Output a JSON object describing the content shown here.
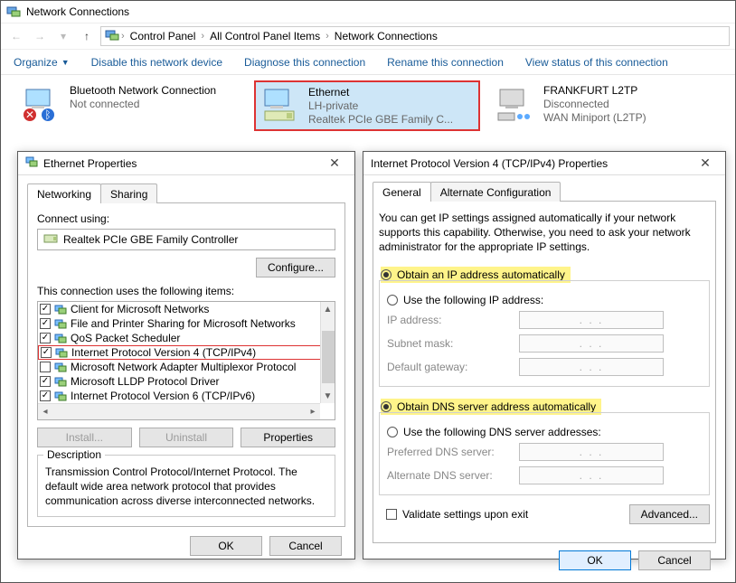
{
  "explorer": {
    "title": "Network Connections",
    "breadcrumbs": [
      "Control Panel",
      "All Control Panel Items",
      "Network Connections"
    ],
    "commands": {
      "organize": "Organize",
      "disable": "Disable this network device",
      "diagnose": "Diagnose this connection",
      "rename": "Rename this connection",
      "viewstatus": "View status of this connection"
    },
    "connections": [
      {
        "name": "Bluetooth Network Connection",
        "status": "Not connected",
        "detail": ""
      },
      {
        "name": "Ethernet",
        "status": "LH-private",
        "detail": "Realtek PCIe GBE Family C...",
        "selected": true
      },
      {
        "name": "FRANKFURT L2TP",
        "status": "Disconnected",
        "detail": "WAN Miniport (L2TP)"
      }
    ]
  },
  "ethProps": {
    "title": "Ethernet Properties",
    "tabs": {
      "networking": "Networking",
      "sharing": "Sharing"
    },
    "connect_using": "Connect using:",
    "adapter": "Realtek PCIe GBE Family Controller",
    "configure": "Configure...",
    "items_label": "This connection uses the following items:",
    "items": [
      {
        "checked": true,
        "label": "Client for Microsoft Networks"
      },
      {
        "checked": true,
        "label": "File and Printer Sharing for Microsoft Networks"
      },
      {
        "checked": true,
        "label": "QoS Packet Scheduler"
      },
      {
        "checked": true,
        "label": "Internet Protocol Version 4 (TCP/IPv4)",
        "highlight": true
      },
      {
        "checked": false,
        "label": "Microsoft Network Adapter Multiplexor Protocol"
      },
      {
        "checked": true,
        "label": "Microsoft LLDP Protocol Driver"
      },
      {
        "checked": true,
        "label": "Internet Protocol Version 6 (TCP/IPv6)"
      }
    ],
    "install": "Install...",
    "uninstall": "Uninstall",
    "properties": "Properties",
    "desc_title": "Description",
    "desc_body": "Transmission Control Protocol/Internet Protocol. The default wide area network protocol that provides communication across diverse interconnected networks.",
    "ok": "OK",
    "cancel": "Cancel"
  },
  "ipv4": {
    "title": "Internet Protocol Version 4 (TCP/IPv4) Properties",
    "tabs": {
      "general": "General",
      "alt": "Alternate Configuration"
    },
    "desc": "You can get IP settings assigned automatically if your network supports this capability. Otherwise, you need to ask your network administrator for the appropriate IP settings.",
    "auto_ip": "Obtain an IP address automatically",
    "use_ip": "Use the following IP address:",
    "ip_address": "IP address:",
    "subnet": "Subnet mask:",
    "gateway": "Default gateway:",
    "auto_dns": "Obtain DNS server address automatically",
    "use_dns": "Use the following DNS server addresses:",
    "pref_dns": "Preferred DNS server:",
    "alt_dns": "Alternate DNS server:",
    "validate": "Validate settings upon exit",
    "advanced": "Advanced...",
    "ip_placeholder": ".     .     .",
    "ok": "OK",
    "cancel": "Cancel"
  }
}
